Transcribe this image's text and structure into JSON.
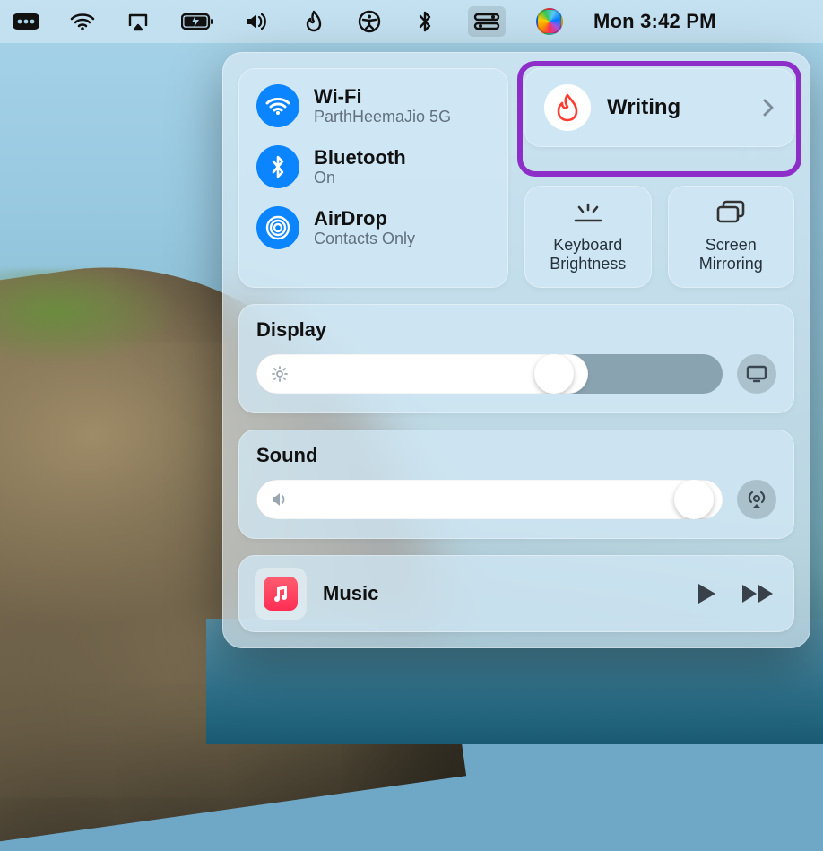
{
  "menubar": {
    "clock": "Mon 3:42 PM"
  },
  "connectivity": {
    "wifi": {
      "title": "Wi-Fi",
      "sub": "ParthHeemaJio 5G"
    },
    "bluetooth": {
      "title": "Bluetooth",
      "sub": "On"
    },
    "airdrop": {
      "title": "AirDrop",
      "sub": "Contacts Only"
    }
  },
  "focus": {
    "label": "Writing"
  },
  "mini": {
    "keyboard": "Keyboard Brightness",
    "mirroring": "Screen Mirroring"
  },
  "display": {
    "title": "Display",
    "brightness_pct": 68
  },
  "sound": {
    "title": "Sound",
    "volume_pct": 98
  },
  "music": {
    "label": "Music"
  }
}
